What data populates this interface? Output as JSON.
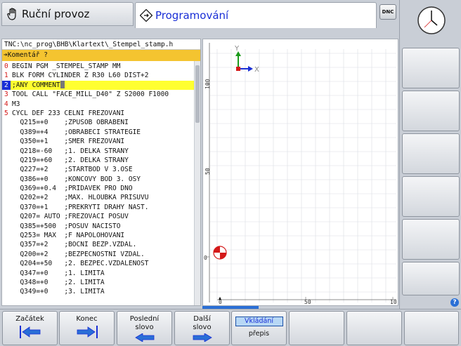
{
  "tabs": {
    "manual": {
      "label": "Ruční provoz",
      "icon": "hand-icon"
    },
    "programming": {
      "label": "Programování",
      "icon": "program-icon"
    },
    "dnc": "DNC"
  },
  "editor": {
    "path": "TNC:\\nc_prog\\BHB\\Klartext\\_Stempel_stamp.h",
    "prompt": "➔Komentář ?",
    "lines": [
      {
        "no": "0",
        "text": "BEGIN PGM _STEMPEL_STAMP MM"
      },
      {
        "no": "1",
        "text": "BLK FORM CYLINDER Z R30 L60 DIST+2"
      },
      {
        "no": "2",
        "text": ";ANY COMMENT"
      },
      {
        "no": "3",
        "text": "TOOL CALL \"FACE_MILL_D40\" Z S2000 F1000"
      },
      {
        "no": "4",
        "text": "M3"
      },
      {
        "no": "5",
        "text": "CYCL DEF 233 CELNI FREZOVANI"
      },
      {
        "no": "",
        "text": "  Q215=+0    ;ZPUSOB OBRABENI"
      },
      {
        "no": "",
        "text": "  Q389=+4    ;OBRABECI STRATEGIE"
      },
      {
        "no": "",
        "text": "  Q350=+1    ;SMER FREZOVANI"
      },
      {
        "no": "",
        "text": "  Q218=-60   ;1. DELKA STRANY"
      },
      {
        "no": "",
        "text": "  Q219=+60   ;2. DELKA STRANY"
      },
      {
        "no": "",
        "text": "  Q227=+2    ;STARTBOD V 3.OSE"
      },
      {
        "no": "",
        "text": "  Q386=+0    ;KONCOVY BOD 3. OSY"
      },
      {
        "no": "",
        "text": "  Q369=+0.4  ;PRIDAVEK PRO DNO"
      },
      {
        "no": "",
        "text": "  Q202=+2    ;MAX. HLOUBKA PRISUVU"
      },
      {
        "no": "",
        "text": "  Q370=+1    ;PREKRYTI DRAHY NAST."
      },
      {
        "no": "",
        "text": "  Q207= AUTO ;FREZOVACI POSUV"
      },
      {
        "no": "",
        "text": "  Q385=+500  ;POSUV NACISTO"
      },
      {
        "no": "",
        "text": "  Q253= MAX  ;F NAPOLOHOVANI"
      },
      {
        "no": "",
        "text": "  Q357=+2    ;BOCNI BEZP.VZDAL."
      },
      {
        "no": "",
        "text": "  Q200=+2    ;BEZPECNOSTNI VZDAL."
      },
      {
        "no": "",
        "text": "  Q204=+50   ;2. BEZPEC.VZDALENOST"
      },
      {
        "no": "",
        "text": "  Q347=+0    ;1. LIMITA"
      },
      {
        "no": "",
        "text": "  Q348=+0    ;2. LIMITA"
      },
      {
        "no": "",
        "text": "  Q349=+0    ;3. LIMITA"
      }
    ]
  },
  "graphic": {
    "axis_y": "Y",
    "axis_x": "X",
    "vruler": [
      "100",
      "50",
      "0"
    ],
    "hruler": [
      "0",
      "50",
      "10"
    ]
  },
  "softkeys": {
    "start": "Začátek",
    "end": "Konec",
    "last_word": [
      "Poslední",
      "slovo"
    ],
    "next_word": [
      "Další",
      "slovo"
    ],
    "insert": "Vkládání",
    "overwrite": "přepis"
  },
  "help": "?",
  "colors": {
    "accent": "#1a2fd6",
    "prompt_bg": "#f4c430",
    "highlight": "#ffff30"
  }
}
